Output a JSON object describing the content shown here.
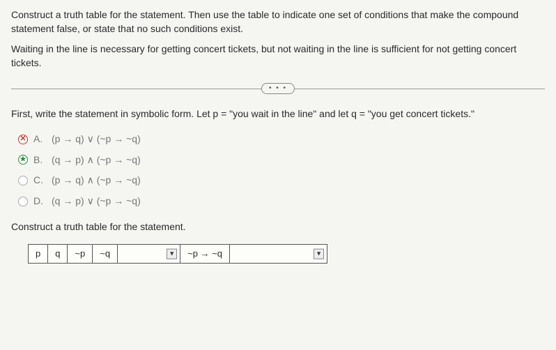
{
  "intro": "Construct a truth table for the statement. Then use the table to indicate one set of conditions that make the compound statement false, or state that no such conditions exist.",
  "statement": "Waiting in the line is necessary for getting concert tickets, but not waiting in the line is sufficient for not getting concert tickets.",
  "divider_dots": "• • •",
  "prompt": "First, write the statement in symbolic form. Let p = \"you wait in the line\" and let q = \"you get concert tickets.\"",
  "options": {
    "a": {
      "label": "A.",
      "expr": "(p → q) ∨ (~p → ~q)"
    },
    "b": {
      "label": "B.",
      "expr": "(q → p) ∧ (~p → ~q)"
    },
    "c": {
      "label": "C.",
      "expr": "(p → q) ∧ (~p → ~q)"
    },
    "d": {
      "label": "D.",
      "expr": "(q → p) ∨ (~p → ~q)"
    }
  },
  "instruct2": "Construct a truth table for the statement.",
  "table": {
    "h1": "p",
    "h2": "q",
    "h3": "~p",
    "h4": "~q",
    "h5_dropdown": "",
    "h6": "~p → ~q",
    "h7_dropdown": "",
    "arrow": "▼"
  }
}
